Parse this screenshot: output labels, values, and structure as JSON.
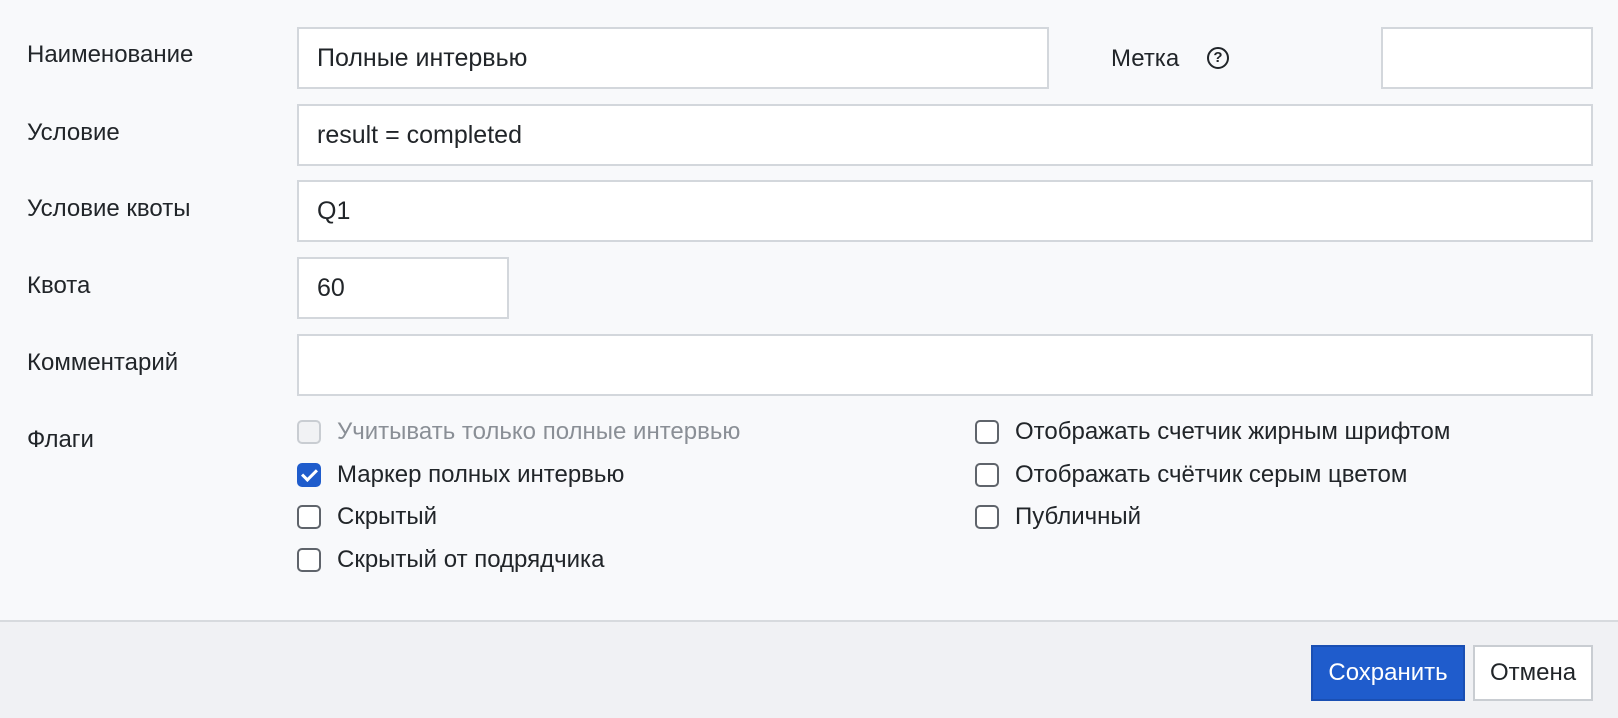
{
  "form": {
    "name": {
      "label": "Наименование",
      "value": "Полные интервью"
    },
    "tag": {
      "label": "Метка",
      "value": ""
    },
    "condition": {
      "label": "Условие",
      "value": "result = completed"
    },
    "quota_condition": {
      "label": "Условие квоты",
      "value": "Q1"
    },
    "quota": {
      "label": "Квота",
      "value": "60"
    },
    "comment": {
      "label": "Комментарий",
      "value": ""
    },
    "flags": {
      "label": "Флаги",
      "items": [
        {
          "label": "Учитывать только полные интервью",
          "checked": false,
          "disabled": true
        },
        {
          "label": "Маркер полных интервью",
          "checked": true,
          "disabled": false
        },
        {
          "label": "Скрытый",
          "checked": false,
          "disabled": false
        },
        {
          "label": "Скрытый от подрядчика",
          "checked": false,
          "disabled": false
        },
        {
          "label": "Отображать счетчик жирным шрифтом",
          "checked": false,
          "disabled": false
        },
        {
          "label": "Отображать счётчик серым цветом",
          "checked": false,
          "disabled": false
        },
        {
          "label": "Публичный",
          "checked": false,
          "disabled": false
        }
      ]
    }
  },
  "icons": {
    "help": "question-circle-icon"
  },
  "footer": {
    "save_label": "Сохранить",
    "cancel_label": "Отмена"
  },
  "colors": {
    "primary": "#1f5ccc",
    "background": "#f8f9fb",
    "footer": "#f0f1f4",
    "input_border": "#d3d7dc",
    "disabled_text": "#8a8f96"
  }
}
